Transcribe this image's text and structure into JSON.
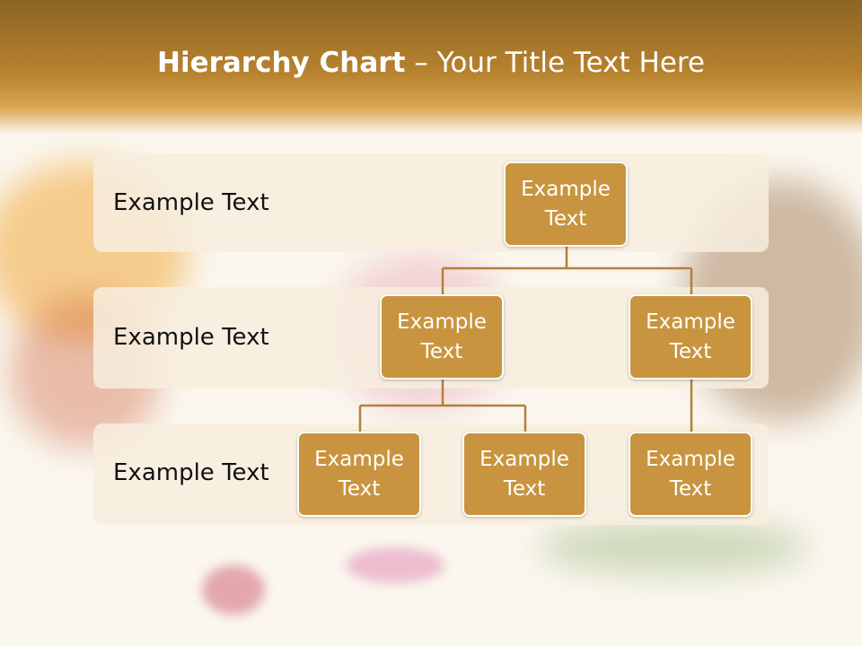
{
  "title": {
    "bold": "Hierarchy Chart",
    "rest": " – Your Title Text Here"
  },
  "levels": [
    {
      "label": "Example Text"
    },
    {
      "label": "Example Text"
    },
    {
      "label": "Example Text"
    }
  ],
  "nodes": {
    "root": "Example Text",
    "level2_left": "Example Text",
    "level2_right": "Example Text",
    "level3_left": "Example Text",
    "level3_middle": "Example Text",
    "level3_right": "Example Text"
  },
  "colors": {
    "header": "#a87727",
    "node": "#c8943f",
    "connector": "#b3803a",
    "band": "#f7eede"
  }
}
